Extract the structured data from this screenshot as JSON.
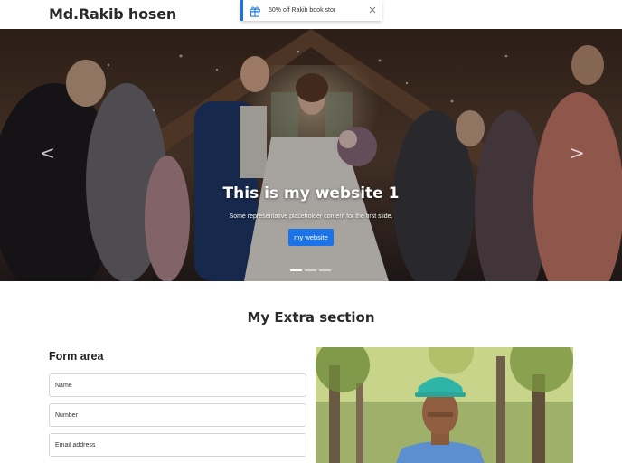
{
  "header": {
    "brand": "Md.Rakib hosen"
  },
  "toast": {
    "message": "50% off Rakib book stor",
    "icon": "gift-icon",
    "close_icon": "close-icon",
    "accent": "#1a73e8"
  },
  "carousel": {
    "prev_glyph": "<",
    "next_glyph": ">",
    "slide": {
      "title": "This is my website 1",
      "text": "Some representative placeholder content for the first slide.",
      "button_label": "my website"
    },
    "indicator_count": 3,
    "active_index": 0
  },
  "extra": {
    "title": "My Extra section",
    "form_title": "Form area",
    "fields": [
      {
        "placeholder": "Name"
      },
      {
        "placeholder": "Number"
      },
      {
        "placeholder": "Email address"
      }
    ]
  },
  "colors": {
    "primary": "#1a73e8",
    "text_dark": "#2b2b2b"
  }
}
